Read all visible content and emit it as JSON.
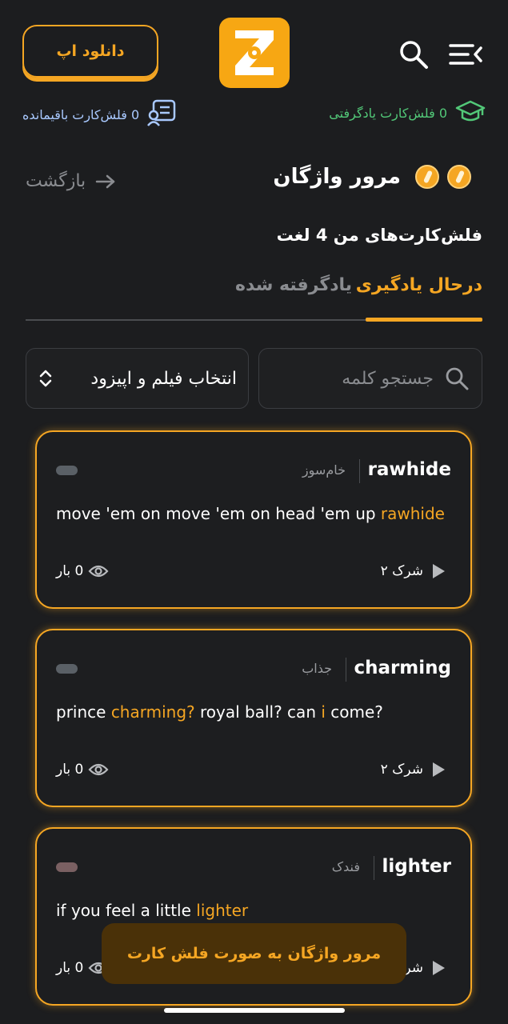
{
  "header": {
    "download_label": "دانلود اپ"
  },
  "stats": {
    "remaining": "0 فلش‌کارت باقیمانده",
    "learned": "0 فلش‌کارت یادگرفتی"
  },
  "nav": {
    "back_label": "بازگشت",
    "title": "مرور واژگان"
  },
  "subtitle": "فلش‌کارت‌های من  4 لغت",
  "tabs": [
    {
      "label": "درحال یادگیری",
      "active": true
    },
    {
      "label": "یادگرفته شده",
      "active": false
    }
  ],
  "filters": {
    "film_select": "انتخاب فیلم و اپیزود",
    "search_placeholder": "جستجو کلمه"
  },
  "cards": [
    {
      "word": "rawhide",
      "translation": "خام‌سوز",
      "sentence": [
        {
          "t": "move 'em on move 'em on head 'em up "
        },
        {
          "t": "rawhide",
          "hl": true
        }
      ],
      "source": "شرک ۲",
      "views": "0 بار",
      "pill_color": "#5a6066"
    },
    {
      "word": "charming",
      "translation": "جذاب",
      "sentence": [
        {
          "t": "prince "
        },
        {
          "t": "charming?",
          "hl": true
        },
        {
          "t": " royal ball? can "
        },
        {
          "t": "i",
          "hl": true
        },
        {
          "t": " come?"
        }
      ],
      "source": "شرک ۲",
      "views": "0 بار",
      "pill_color": "#5a6066"
    },
    {
      "word": "lighter",
      "translation": "فندک",
      "sentence": [
        {
          "t": "if you feel a little "
        },
        {
          "t": "lighter",
          "hl": true
        }
      ],
      "source": "شرک ۲",
      "views": "0 بار",
      "pill_color": "#7a6062"
    }
  ],
  "float_button": "مرور واژگان به صورت فلش کارت",
  "colors": {
    "accent": "#f5a623",
    "background": "#1c1d1f",
    "learned_green": "#52c878",
    "remaining_blue": "#a9c9ff"
  }
}
